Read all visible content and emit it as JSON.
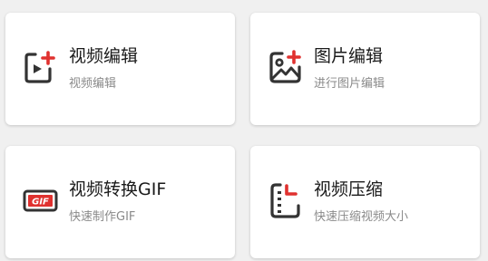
{
  "theme": {
    "accent": "#e0312f",
    "icon_dark": "#333333",
    "background": "#f0f0f0",
    "card": "#ffffff",
    "title_color": "#1a1a1a",
    "subtitle_color": "#8a8a8a"
  },
  "cards": [
    {
      "title": "视频编辑",
      "subtitle": "视频编辑",
      "icon": "video-edit-icon"
    },
    {
      "title": "图片编辑",
      "subtitle": "进行图片编辑",
      "icon": "image-edit-icon"
    },
    {
      "title": "视频转换GIF",
      "subtitle": "快速制作GIF",
      "icon": "gif-icon",
      "icon_text": "GIF"
    },
    {
      "title": "视频压缩",
      "subtitle": "快速压缩视频大小",
      "icon": "video-compress-icon"
    }
  ]
}
